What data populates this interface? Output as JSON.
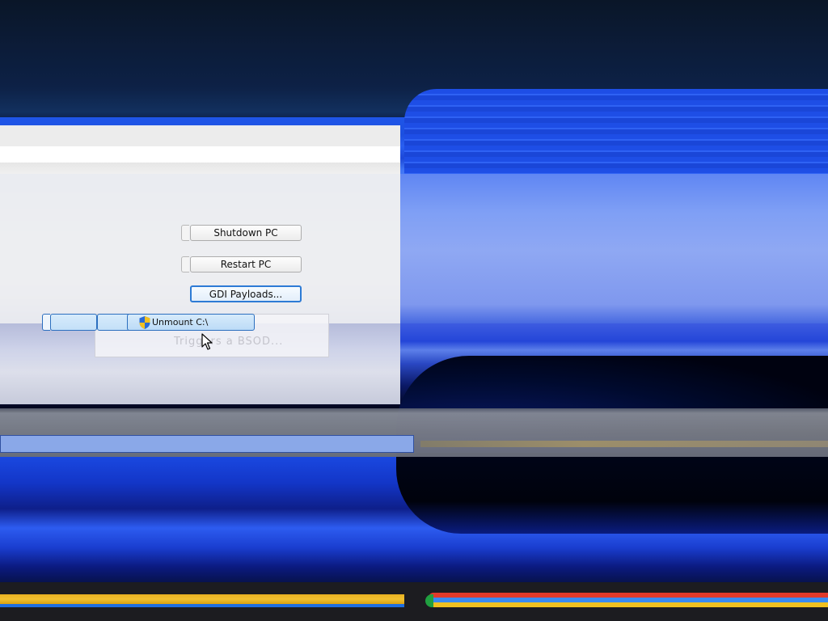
{
  "dialog": {
    "buttons": {
      "shutdown": "Shutdown PC",
      "restart": "Restart PC",
      "gdi": "GDI Payloads...",
      "unmount": "Unmount C:\\"
    },
    "tooltip": "Triggers a BSOD..."
  },
  "icons": {
    "uac_shield": "uac-shield-icon",
    "cursor": "mouse-pointer-icon"
  },
  "colors": {
    "accent_blue": "#2d7bd5",
    "taskbar": "#1c1c20",
    "glitch_yellow": "#f0c030",
    "glitch_red": "#e03a2a",
    "glitch_blue": "#3a8af0"
  }
}
